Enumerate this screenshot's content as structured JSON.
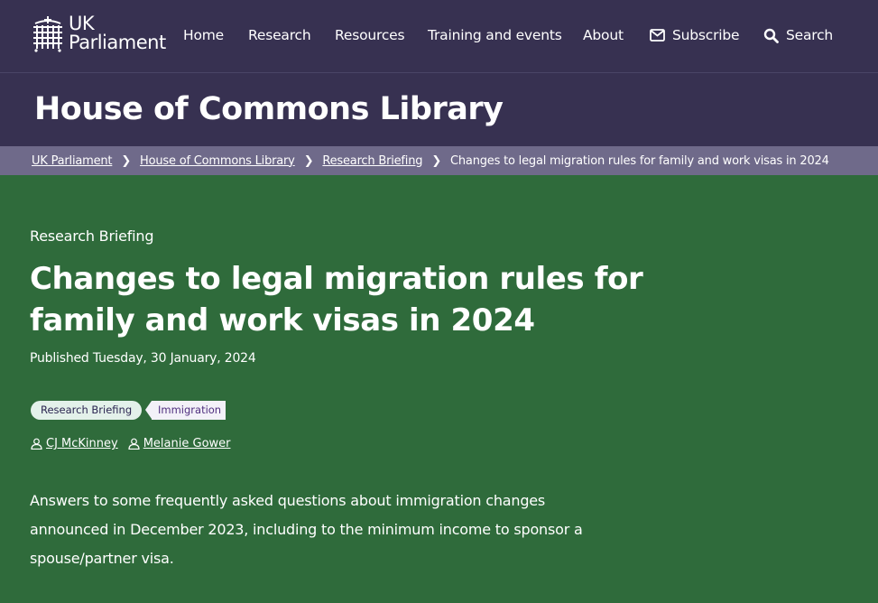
{
  "header": {
    "logo_line1": "UK",
    "logo_line2": "Parliament",
    "nav": [
      "Home",
      "Research",
      "Resources",
      "Training and events",
      "About"
    ],
    "subscribe_label": "Subscribe",
    "search_label": "Search",
    "icons": {
      "subscribe": "envelope-icon",
      "search": "magnifier-icon",
      "logo": "portcullis-icon"
    }
  },
  "banner": {
    "title": "House of Commons Library"
  },
  "breadcrumb": {
    "items": [
      "UK Parliament",
      "House of Commons Library",
      "Research Briefing"
    ],
    "current": "Changes to legal migration rules for family and work visas in 2024"
  },
  "article": {
    "kicker": "Research Briefing",
    "title": "Changes to legal migration rules for family and work visas in 2024",
    "published": "Published Tuesday, 30 January, 2024",
    "tags": [
      "Research Briefing",
      "Immigration"
    ],
    "authors": [
      "CJ McKinney",
      "Melanie Gower"
    ],
    "summary": "Answers to some frequently asked questions about immigration changes announced in December 2023, including to the minimum income to sponsor a spouse/partner visa."
  },
  "colors": {
    "header_bg": "#373151",
    "breadcrumb_bg": "#6f6a8a",
    "main_bg": "#2f6b3b",
    "tag_research_bg": "#e3f1ea",
    "tag_immigration_bg": "#f3f1f8"
  }
}
